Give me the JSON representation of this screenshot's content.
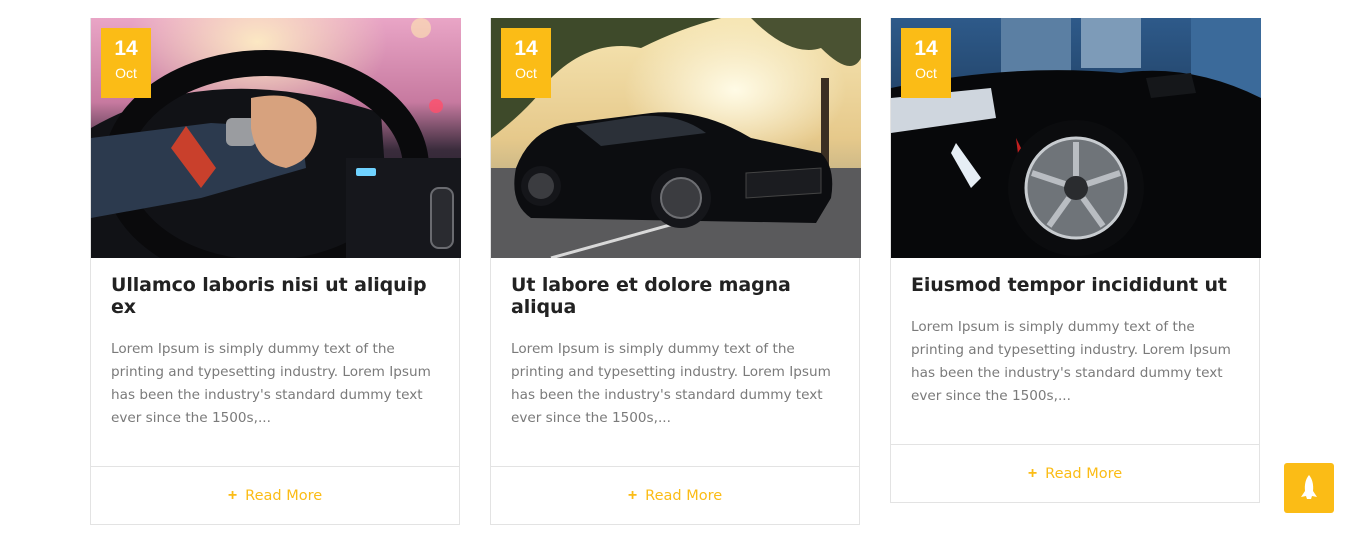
{
  "posts": [
    {
      "day": "14",
      "month": "Oct",
      "title": "Ullamco laboris nisi ut aliquip ex",
      "excerpt": "Lorem Ipsum is simply dummy text of the printing and typesetting industry. Lorem Ipsum has been the industry's standard dummy text ever since the 1500s,...",
      "read_more": "Read More",
      "image": "driver-hands-on-steering-wheel"
    },
    {
      "day": "14",
      "month": "Oct",
      "title": "Ut labore et dolore magna aliqua",
      "excerpt": "Lorem Ipsum is simply dummy text of the printing and typesetting industry. Lorem Ipsum has been the industry's standard dummy text ever since the 1500s,...",
      "read_more": "Read More",
      "image": "black-muscle-car-at-sunset"
    },
    {
      "day": "14",
      "month": "Oct",
      "title": "Eiusmod tempor incididunt ut",
      "excerpt": "Lorem Ipsum is simply dummy text of the printing and typesetting industry. Lorem Ipsum has been the industry's standard dummy text ever since the 1500s,...",
      "read_more": "Read More",
      "image": "black-car-front-wheel-city"
    }
  ],
  "colors": {
    "accent": "#fbbc16",
    "title": "#222222",
    "text": "#7a7a7a",
    "border": "#e3e3e3"
  },
  "scroll_top": {
    "icon": "rocket-icon"
  }
}
